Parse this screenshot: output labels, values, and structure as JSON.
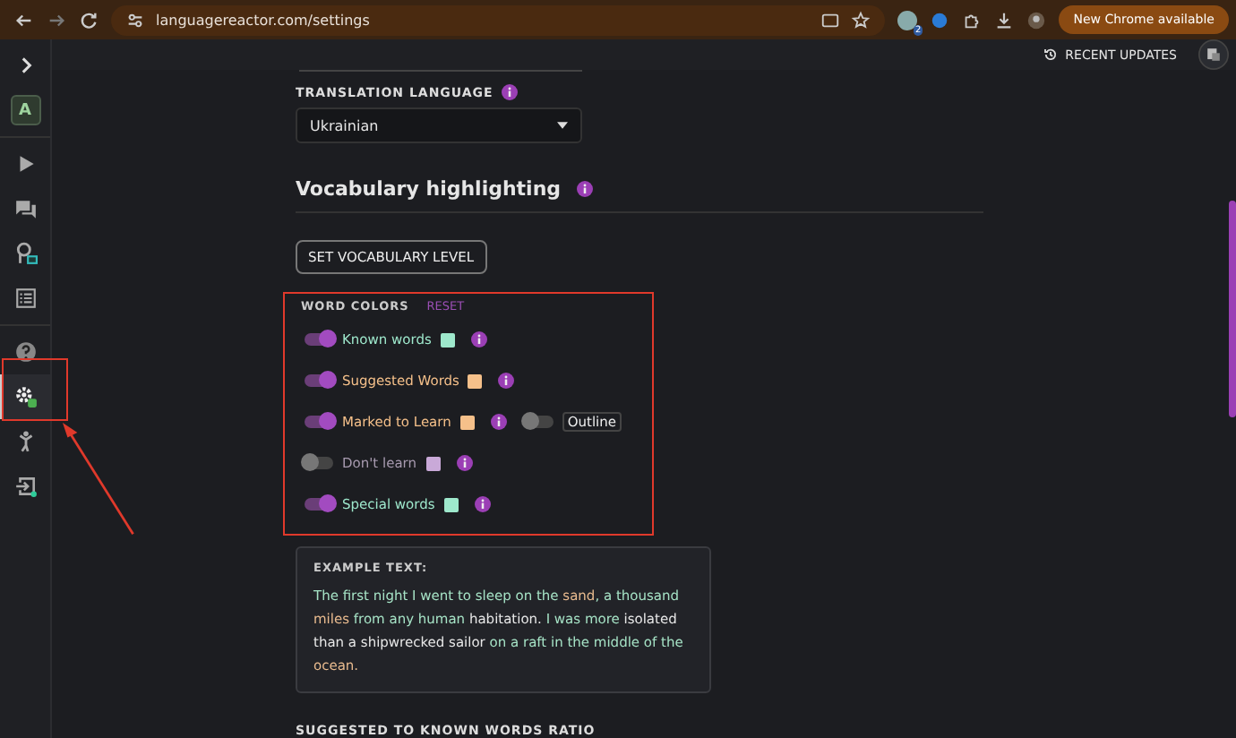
{
  "browser": {
    "url": "languagereactor.com/settings",
    "update_button": "New Chrome available",
    "extension_badge": "2"
  },
  "sidebar": {
    "items": [
      {
        "kind": "expand",
        "selected": false
      },
      {
        "kind": "logo",
        "label": "A",
        "selected": false
      },
      {
        "kind": "play",
        "selected": false
      },
      {
        "kind": "chat",
        "selected": false
      },
      {
        "kind": "phrasepump",
        "selected": false
      },
      {
        "kind": "list",
        "selected": false
      },
      {
        "kind": "help",
        "selected": false
      },
      {
        "kind": "settings",
        "selected": true
      },
      {
        "kind": "person",
        "selected": false
      },
      {
        "kind": "exit",
        "selected": false
      }
    ]
  },
  "header": {
    "recent_updates": "RECENT UPDATES"
  },
  "translation_language": {
    "label": "TRANSLATION LANGUAGE",
    "value": "Ukrainian"
  },
  "vocabulary": {
    "heading": "Vocabulary highlighting",
    "set_level_button": "SET VOCABULARY LEVEL",
    "word_colors_label": "WORD COLORS",
    "reset": "RESET",
    "rows": [
      {
        "label": "Known words",
        "on": true,
        "color": "#9ee8cc"
      },
      {
        "label": "Suggested Words",
        "on": true,
        "color": "#f5c08a"
      },
      {
        "label": "Marked to Learn",
        "on": true,
        "color": "#f5c08a",
        "outline": {
          "label": "Outline",
          "on": false
        }
      },
      {
        "label": "Don't learn",
        "on": false,
        "color": "#c9a9d8"
      },
      {
        "label": "Special words",
        "on": true,
        "color": "#9ee8cc"
      }
    ]
  },
  "example": {
    "label": "EXAMPLE TEXT:",
    "segments": [
      {
        "text": "The first night I went to sleep on the ",
        "kind": "known"
      },
      {
        "text": "sand",
        "kind": "suggested"
      },
      {
        "text": ", a thousand ",
        "kind": "known"
      },
      {
        "text": "miles",
        "kind": "suggested"
      },
      {
        "text": " from any human ",
        "kind": "known"
      },
      {
        "text": "habitation.",
        "kind": "plain"
      },
      {
        "text": " I was more ",
        "kind": "known"
      },
      {
        "text": "isolated than a ",
        "kind": "plain"
      },
      {
        "text": "shipwrecked sailor",
        "kind": "plain"
      },
      {
        "text": " on a raft in the middle of the ",
        "kind": "known"
      },
      {
        "text": "ocean.",
        "kind": "suggested"
      }
    ]
  },
  "ratio": {
    "label": "SUGGESTED TO KNOWN WORDS RATIO"
  }
}
